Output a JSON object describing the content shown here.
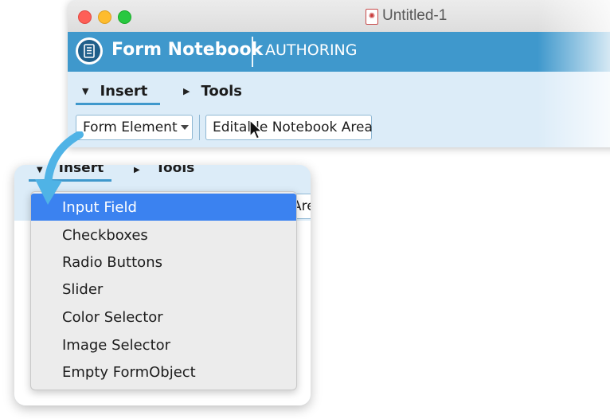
{
  "window": {
    "title": "Untitled-1"
  },
  "app": {
    "name": "Form Notebook",
    "mode": "AUTHORING"
  },
  "ribbon": {
    "tabs": [
      {
        "label": "Insert",
        "expanded": true
      },
      {
        "label": "Tools",
        "expanded": false
      }
    ],
    "buttons": {
      "form_element": "Form Element",
      "editable_area": "Editable Notebook Area"
    }
  },
  "zoom_panel": {
    "peek_button_text": "Area"
  },
  "menu": {
    "items": [
      {
        "label": "Input Field",
        "selected": true
      },
      {
        "label": "Checkboxes",
        "selected": false
      },
      {
        "label": "Radio Buttons",
        "selected": false
      },
      {
        "label": "Slider",
        "selected": false
      },
      {
        "label": "Color Selector",
        "selected": false
      },
      {
        "label": "Image Selector",
        "selected": false
      },
      {
        "label": "Empty FormObject",
        "selected": false
      }
    ]
  },
  "colors": {
    "app_bar": "#3f98cc",
    "ribbon_bg": "#dcecf8",
    "menu_highlight": "#3b82f0",
    "arrow": "#4fb3e6"
  },
  "icons": {
    "app_logo": "notebook-icon",
    "document": "document-icon",
    "cursor": "mouse-pointer-icon",
    "arrow": "curved-arrow-icon"
  }
}
